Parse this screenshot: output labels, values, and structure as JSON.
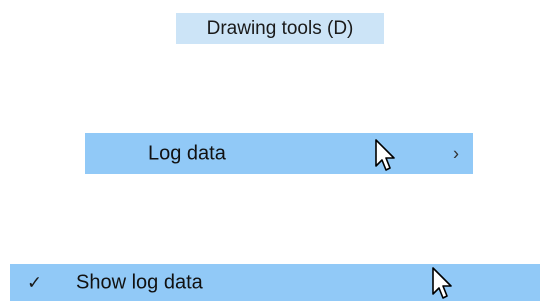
{
  "tooltip": {
    "text": "Drawing tools (D)"
  },
  "submenu_item": {
    "label": "Log data",
    "chevron": "›"
  },
  "checked_item": {
    "check": "✓",
    "label": "Show log data"
  },
  "colors": {
    "tooltip_bg": "#cce4f7",
    "highlight_bg": "#91c9f7"
  },
  "icons": [
    "pointer-cursor-icon",
    "chevron-right-icon",
    "checkmark-icon"
  ]
}
